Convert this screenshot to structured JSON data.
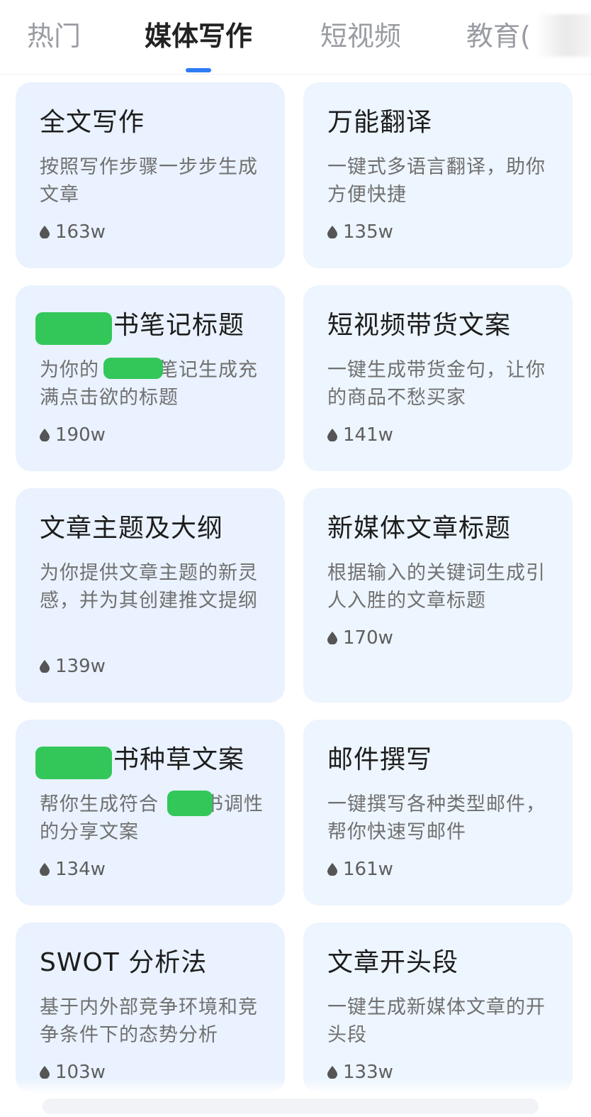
{
  "tabs": [
    {
      "label": "热门"
    },
    {
      "label": "媒体写作"
    },
    {
      "label": "短视频"
    },
    {
      "label": "教育("
    }
  ],
  "active_tab": "媒体写作",
  "colors": {
    "accent": "#2f7cf6",
    "card_bg": "#e9f2fe",
    "redaction": "#33c75a"
  },
  "cards": [
    {
      "title": "全文写作",
      "desc": "按照写作步骤一步步生成文章",
      "views": "163w"
    },
    {
      "title": "万能翻译",
      "desc": "一键式多语言翻译，助你方便快捷",
      "views": "135w"
    },
    {
      "title": "书笔记标题",
      "desc_a": "为你的",
      "desc_b": "笔记生成充满点击欲的标题",
      "views": "190w"
    },
    {
      "title": "短视频带货文案",
      "desc": "一键生成带货金句，让你的商品不愁买家",
      "views": "141w"
    },
    {
      "title": "文章主题及大纲",
      "desc": "为你提供文章主题的新灵感，并为其创建推文提纲",
      "views": "139w"
    },
    {
      "title": "新媒体文章标题",
      "desc": "根据输入的关键词生成引人入胜的文章标题",
      "views": "170w"
    },
    {
      "title": "书种草文案",
      "desc_a": "帮你生成符合",
      "desc_b": "书调性的分享文案",
      "views": "134w"
    },
    {
      "title": "邮件撰写",
      "desc": "一键撰写各种类型邮件，帮你快速写邮件",
      "views": "161w"
    },
    {
      "title": "SWOT 分析法",
      "desc": "基于内外部竞争环境和竞争条件下的态势分析",
      "views": "103w"
    },
    {
      "title": "文章开头段",
      "desc": "一键生成新媒体文章的开头段",
      "views": "133w"
    }
  ],
  "icons": {
    "views": "flame-drop-icon"
  }
}
